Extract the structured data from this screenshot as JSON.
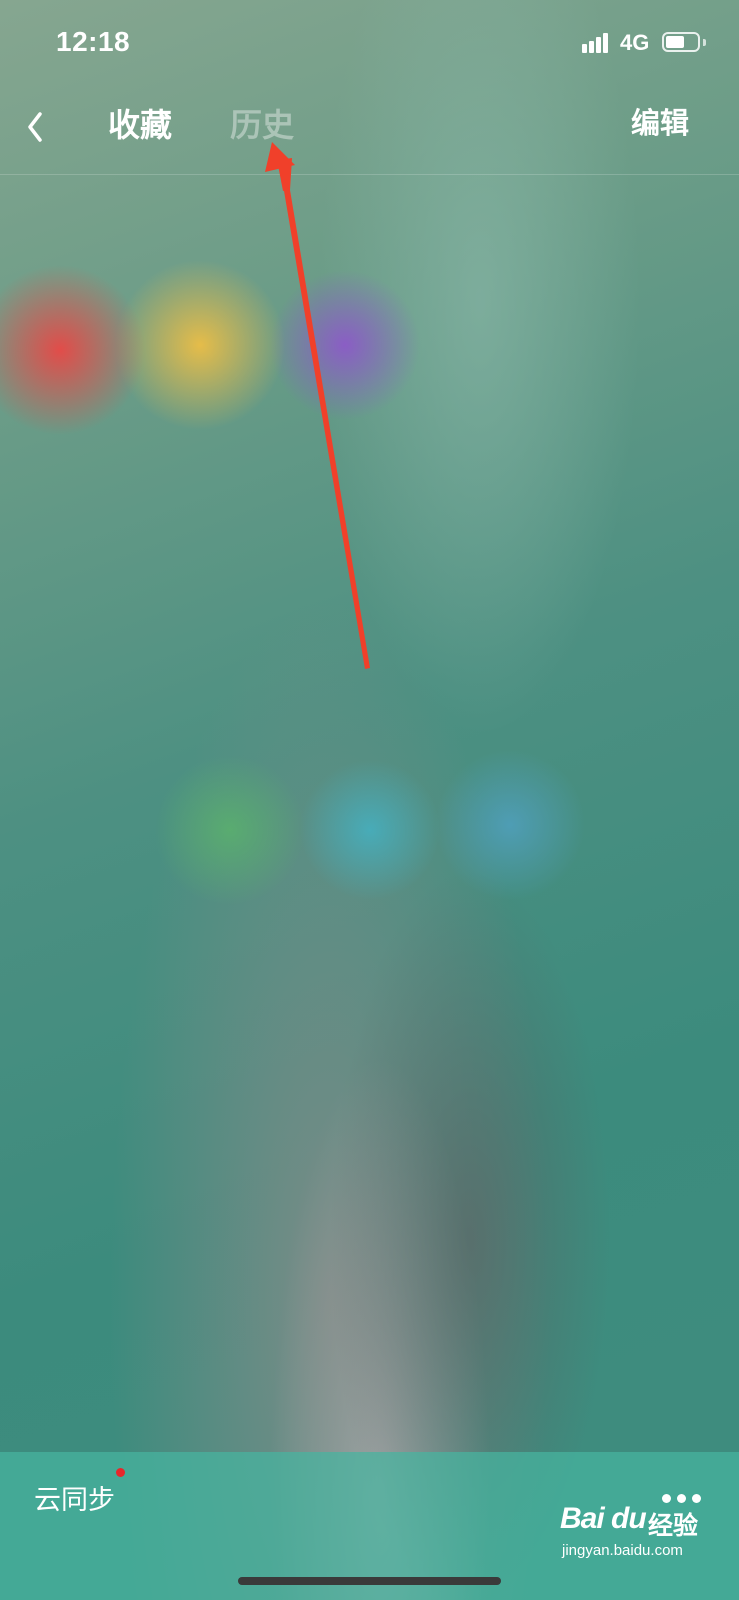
{
  "status_bar": {
    "time": "12:18",
    "network": "4G",
    "battery_level": 0.55,
    "icons": [
      "signal-icon",
      "battery-icon"
    ]
  },
  "nav": {
    "back_icon": "chevron-left-icon",
    "tabs": [
      {
        "label": "收藏",
        "active": true
      },
      {
        "label": "历史",
        "active": false
      }
    ],
    "edit_label": "编辑"
  },
  "annotation": {
    "type": "red-arrow",
    "color": "#f0402a",
    "points_to": "历史"
  },
  "bottom_bar": {
    "cloud_sync_label": "云同步",
    "badge_color": "#e8262a",
    "more_icon": "more-dots-icon"
  },
  "watermark": {
    "brand": "Bai du",
    "brand_cn": "经验",
    "url": "jingyan.baidu.com"
  },
  "colors": {
    "background": "#3e8e80",
    "bottom_bar": "#46b4a0",
    "text": "#ffffff"
  }
}
